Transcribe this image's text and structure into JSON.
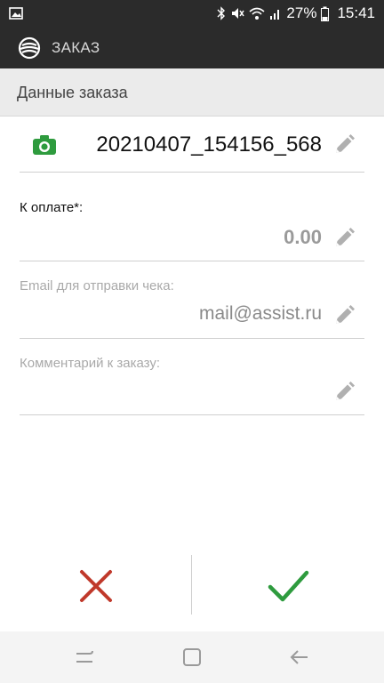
{
  "status_bar": {
    "battery": "27%",
    "time": "15:41"
  },
  "app_bar": {
    "title": "ЗАКАЗ"
  },
  "section": {
    "title": "Данные заказа"
  },
  "form": {
    "order_number": "20210407_154156_568",
    "amount_label": "К оплате*:",
    "amount_value": "0.00",
    "email_label": "Email для отправки чека:",
    "email_value": "mail@assist.ru",
    "comment_label": "Комментарий к заказу:",
    "comment_value": ""
  },
  "colors": {
    "bar": "#2b2b2b",
    "cancel": "#c0392b",
    "confirm": "#2e9b3e",
    "camera": "#2e9b3e"
  },
  "icons": {
    "camera": "camera-icon",
    "edit": "pencil-icon",
    "cancel": "close-icon",
    "confirm": "check-icon"
  }
}
